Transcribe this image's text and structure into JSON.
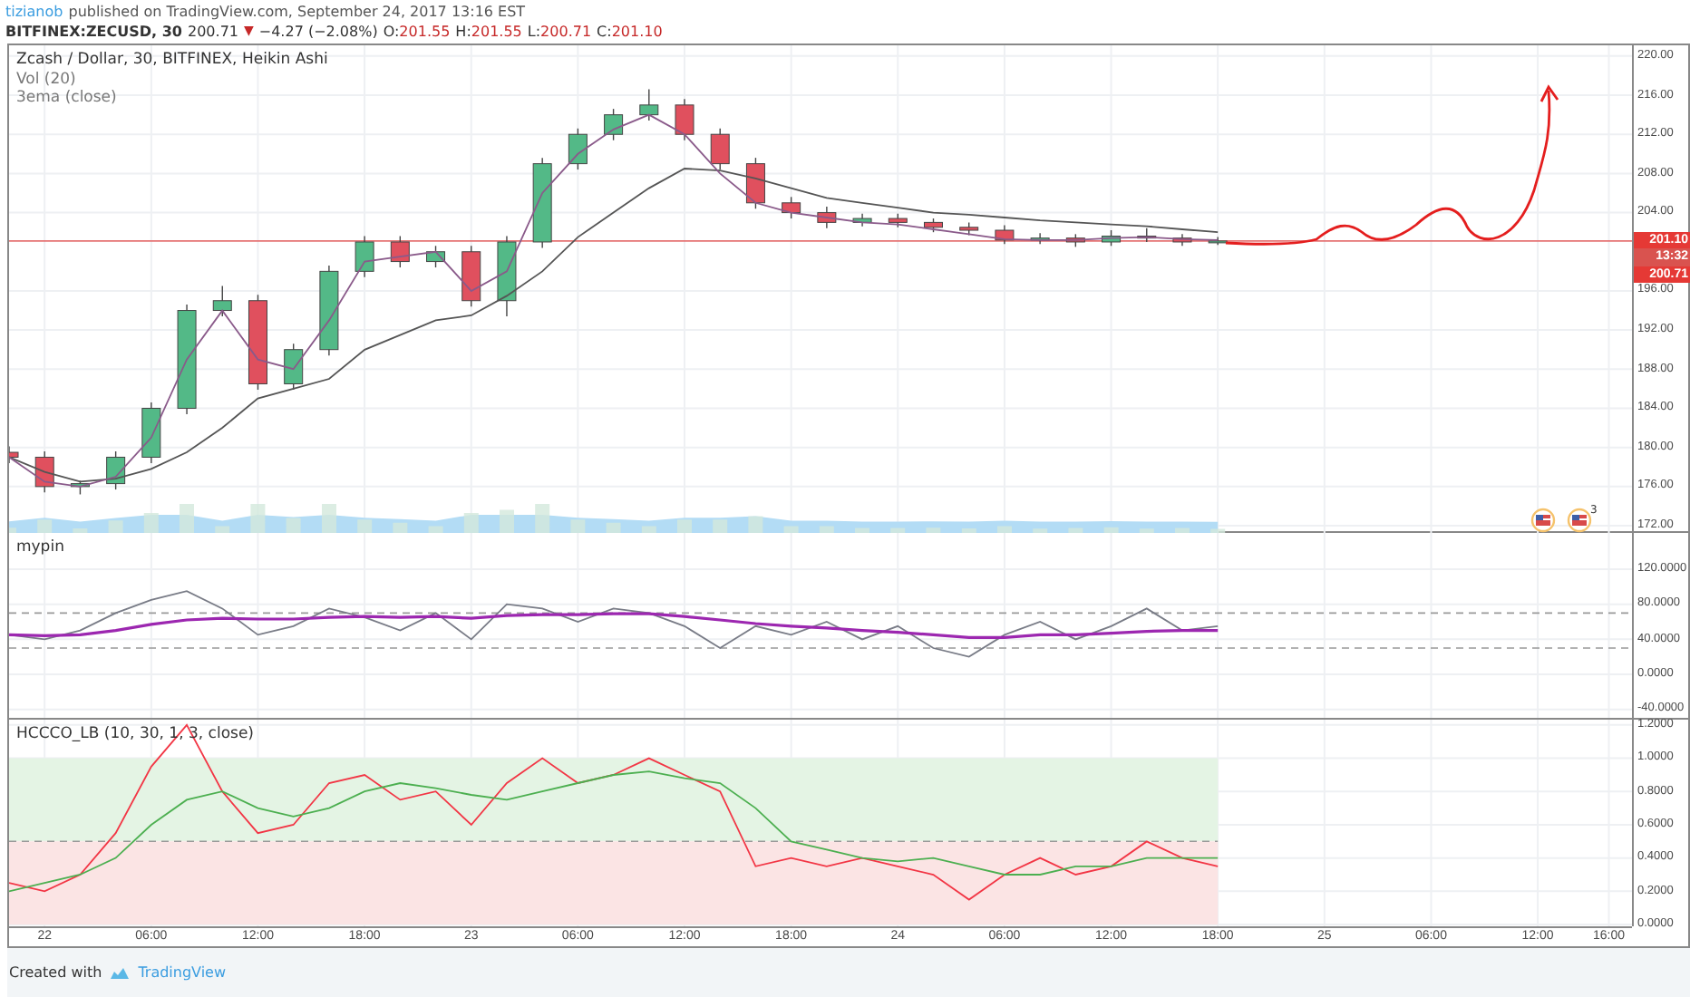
{
  "header": {
    "author": "tizianob",
    "published": "published on TradingView.com, September 24, 2017 13:16 EST",
    "symbol": "BITFINEX:ZECUSD, 30",
    "last": "200.71",
    "direction_glyph": "▼",
    "change": "−4.27 (−2.08%)",
    "ohlc": [
      {
        "label": "O:",
        "value": "201.55"
      },
      {
        "label": "H:",
        "value": "201.55"
      },
      {
        "label": "L:",
        "value": "200.71"
      },
      {
        "label": "C:",
        "value": "201.10"
      }
    ]
  },
  "price_pane": {
    "legend": [
      "Zcash / Dollar, 30, BITFINEX, Heikin Ashi",
      "Vol (20)",
      "3ema (close)"
    ],
    "chart_data": {
      "type": "candlestick",
      "xlim": [
        "2017-09-21T22:00",
        "2017-09-25T20:40"
      ],
      "ylim": [
        171.26,
        221.1
      ],
      "grid": true,
      "x": [
        "2017-09-21T22:00",
        "2017-09-22T00:00",
        "2017-09-22T02:00",
        "2017-09-22T04:00",
        "2017-09-22T06:00",
        "2017-09-22T08:00",
        "2017-09-22T10:00",
        "2017-09-22T12:00",
        "2017-09-22T14:00",
        "2017-09-22T16:00",
        "2017-09-22T18:00",
        "2017-09-22T20:00",
        "2017-09-22T22:00",
        "2017-09-23T00:00",
        "2017-09-23T02:00",
        "2017-09-23T04:00",
        "2017-09-23T06:00",
        "2017-09-23T08:00",
        "2017-09-23T10:00",
        "2017-09-23T12:00",
        "2017-09-23T14:00",
        "2017-09-23T16:00",
        "2017-09-23T18:00",
        "2017-09-23T20:00",
        "2017-09-23T22:00",
        "2017-09-24T00:00",
        "2017-09-24T02:00",
        "2017-09-24T04:00",
        "2017-09-24T06:00",
        "2017-09-24T08:00",
        "2017-09-24T10:00",
        "2017-09-24T12:00",
        "2017-09-24T14:00",
        "2017-09-24T16:00",
        "2017-09-24T18:00"
      ],
      "ohlc": [
        [
          179.5,
          180.1,
          178.4,
          179
        ],
        [
          179,
          179.6,
          175.4,
          176
        ],
        [
          176,
          176.6,
          175.2,
          176.3
        ],
        [
          176.3,
          179.6,
          175.7,
          179
        ],
        [
          179,
          184.6,
          178.4,
          184
        ],
        [
          184,
          194.6,
          183.4,
          194
        ],
        [
          194,
          196.5,
          193.4,
          195
        ],
        [
          195,
          195.6,
          185.9,
          186.5
        ],
        [
          186.5,
          190.6,
          185.9,
          190
        ],
        [
          190,
          198.6,
          189.4,
          198
        ],
        [
          198,
          201.6,
          197.4,
          201
        ],
        [
          201,
          201.6,
          198.4,
          199
        ],
        [
          199,
          200.6,
          198.4,
          200
        ],
        [
          200,
          200.6,
          194.4,
          195
        ],
        [
          195,
          201.6,
          193.4,
          201
        ],
        [
          201,
          209.6,
          200.4,
          209
        ],
        [
          209,
          212.6,
          208.4,
          212
        ],
        [
          212,
          214.6,
          211.4,
          214
        ],
        [
          214,
          216.6,
          213.4,
          215
        ],
        [
          215,
          215.6,
          211.4,
          212
        ],
        [
          212,
          212.6,
          208.4,
          209
        ],
        [
          209,
          209.6,
          204.4,
          205
        ],
        [
          205,
          205.6,
          203.4,
          204
        ],
        [
          204,
          204.6,
          202.4,
          203
        ],
        [
          203,
          203.9,
          202.6,
          203.4
        ],
        [
          203.4,
          203.9,
          202.5,
          203
        ],
        [
          203,
          203.4,
          202,
          202.5
        ],
        [
          202.5,
          203,
          201.7,
          202.2
        ],
        [
          202.2,
          202.7,
          200.8,
          201.2
        ],
        [
          201.2,
          201.9,
          200.8,
          201.4
        ],
        [
          201.4,
          201.8,
          200.5,
          201
        ],
        [
          201,
          202.2,
          200.6,
          201.6
        ],
        [
          201.6,
          202.4,
          201,
          201.4
        ],
        [
          201.4,
          201.8,
          200.6,
          201
        ],
        [
          201,
          201.5,
          200.7,
          201.1
        ]
      ],
      "series": [
        {
          "type": "line",
          "color": "#555555",
          "values": [
            179,
            177.5,
            176.5,
            176.8,
            177.8,
            179.5,
            182,
            185,
            186,
            187,
            190,
            191.5,
            193,
            193.5,
            195.5,
            198,
            201.5,
            204,
            206.5,
            208.5,
            208.3,
            207.5,
            206.5,
            205.5,
            205,
            204.5,
            204,
            203.8,
            203.5,
            203.2,
            203,
            202.8,
            202.6,
            202.3,
            202
          ]
        },
        {
          "type": "line",
          "color": "#8a5a8a",
          "values": [
            179,
            176.5,
            176,
            177,
            181,
            189,
            194,
            189,
            188,
            193,
            199,
            199.5,
            200,
            196,
            198,
            206,
            210,
            212.5,
            214,
            212,
            208,
            205,
            204,
            203.5,
            203,
            202.8,
            202.3,
            201.8,
            201.3,
            201.2,
            201.2,
            201.4,
            201.5,
            201.3,
            201.2
          ]
        }
      ],
      "yticks": [
        {
          "value": 220,
          "label": "220.00"
        },
        {
          "value": 216,
          "label": "216.00"
        },
        {
          "value": 212,
          "label": "212.00"
        },
        {
          "value": 208,
          "label": "208.00"
        },
        {
          "value": 204,
          "label": "204.00"
        },
        {
          "value": 196,
          "label": "196.00"
        },
        {
          "value": 192,
          "label": "192.00"
        },
        {
          "value": 188,
          "label": "188.00"
        },
        {
          "value": 184,
          "label": "184.00"
        },
        {
          "value": 180,
          "label": "180.00"
        },
        {
          "value": 176,
          "label": "176.00"
        },
        {
          "value": 172,
          "label": "172.00"
        }
      ],
      "ref_lines": [
        {
          "axis": "y",
          "value": 201.1,
          "color": "#e57373"
        }
      ]
    },
    "price_tags": [
      {
        "text": "201.10",
        "kind": "last"
      },
      {
        "text": "13:32",
        "kind": "countdown"
      },
      {
        "text": "200.71",
        "kind": "close"
      }
    ],
    "events": [
      {
        "kind": "flag"
      },
      {
        "kind": "flag",
        "badge": "3"
      }
    ]
  },
  "panes": [
    {
      "legend": [
        "mypin"
      ],
      "chart_data": {
        "type": "line",
        "xlim": [
          "2017-09-21T22:00",
          "2017-09-25T20:40"
        ],
        "ylim": [
          -49.7,
          161.4
        ],
        "grid": true,
        "x": [
          "2017-09-21T22:00",
          "2017-09-22T00:00",
          "2017-09-22T02:00",
          "2017-09-22T04:00",
          "2017-09-22T06:00",
          "2017-09-22T08:00",
          "2017-09-22T10:00",
          "2017-09-22T12:00",
          "2017-09-22T14:00",
          "2017-09-22T16:00",
          "2017-09-22T18:00",
          "2017-09-22T20:00",
          "2017-09-22T22:00",
          "2017-09-23T00:00",
          "2017-09-23T02:00",
          "2017-09-23T04:00",
          "2017-09-23T06:00",
          "2017-09-23T08:00",
          "2017-09-23T10:00",
          "2017-09-23T12:00",
          "2017-09-23T14:00",
          "2017-09-23T16:00",
          "2017-09-23T18:00",
          "2017-09-23T20:00",
          "2017-09-23T22:00",
          "2017-09-24T00:00",
          "2017-09-24T02:00",
          "2017-09-24T04:00",
          "2017-09-24T06:00",
          "2017-09-24T08:00",
          "2017-09-24T10:00",
          "2017-09-24T12:00",
          "2017-09-24T14:00",
          "2017-09-24T16:00",
          "2017-09-24T18:00"
        ],
        "series": [
          {
            "color": "#787b86",
            "values": [
              45,
              40,
              50,
              70,
              85,
              95,
              75,
              45,
              55,
              75,
              65,
              50,
              70,
              40,
              80,
              75,
              60,
              75,
              70,
              55,
              30,
              55,
              45,
              60,
              40,
              55,
              30,
              20,
              45,
              60,
              40,
              55,
              75,
              50,
              55
            ]
          },
          {
            "color": "#9c27b0",
            "values": [
              45,
              44,
              45,
              50,
              57,
              62,
              64,
              63,
              63,
              65,
              66,
              65,
              66,
              64,
              67,
              68,
              68,
              69,
              69,
              66,
              62,
              58,
              55,
              53,
              50,
              48,
              45,
              42,
              42,
              45,
              45,
              47,
              49,
              50,
              50
            ]
          }
        ],
        "yticks": [
          {
            "value": 120,
            "label": "120.0000"
          },
          {
            "value": 80,
            "label": "80.0000"
          },
          {
            "value": 40,
            "label": "40.0000"
          },
          {
            "value": 0,
            "label": "0.0000"
          },
          {
            "value": -40,
            "label": "-40.0000"
          }
        ],
        "ref_lines": [
          {
            "axis": "y",
            "value": 70,
            "color": "#999999"
          },
          {
            "axis": "y",
            "value": 30,
            "color": "#999999"
          }
        ]
      }
    },
    {
      "legend": [
        "HCCCO_LB (10, 30, 1, 3, close)"
      ],
      "chart_data": {
        "type": "line",
        "xlim": [
          "2017-09-21T22:00",
          "2017-09-25T20:40"
        ],
        "ylim": [
          -0.0106,
          1.232
        ],
        "grid": true,
        "x": [
          "2017-09-21T22:00",
          "2017-09-22T00:00",
          "2017-09-22T02:00",
          "2017-09-22T04:00",
          "2017-09-22T06:00",
          "2017-09-22T08:00",
          "2017-09-22T10:00",
          "2017-09-22T12:00",
          "2017-09-22T14:00",
          "2017-09-22T16:00",
          "2017-09-22T18:00",
          "2017-09-22T20:00",
          "2017-09-22T22:00",
          "2017-09-23T00:00",
          "2017-09-23T02:00",
          "2017-09-23T04:00",
          "2017-09-23T06:00",
          "2017-09-23T08:00",
          "2017-09-23T10:00",
          "2017-09-23T12:00",
          "2017-09-23T14:00",
          "2017-09-23T16:00",
          "2017-09-23T18:00",
          "2017-09-23T20:00",
          "2017-09-23T22:00",
          "2017-09-24T00:00",
          "2017-09-24T02:00",
          "2017-09-24T04:00",
          "2017-09-24T06:00",
          "2017-09-24T08:00",
          "2017-09-24T10:00",
          "2017-09-24T12:00",
          "2017-09-24T14:00",
          "2017-09-24T16:00",
          "2017-09-24T18:00"
        ],
        "series": [
          {
            "color": "#f23645",
            "values": [
              0.25,
              0.2,
              0.3,
              0.55,
              0.95,
              1.2,
              0.8,
              0.55,
              0.6,
              0.85,
              0.9,
              0.75,
              0.8,
              0.6,
              0.85,
              1.0,
              0.85,
              0.9,
              1.0,
              0.9,
              0.8,
              0.35,
              0.4,
              0.35,
              0.4,
              0.35,
              0.3,
              0.15,
              0.3,
              0.4,
              0.3,
              0.35,
              0.5,
              0.4,
              0.35
            ]
          },
          {
            "color": "#4caf50",
            "values": [
              0.2,
              0.25,
              0.3,
              0.4,
              0.6,
              0.75,
              0.8,
              0.7,
              0.65,
              0.7,
              0.8,
              0.85,
              0.82,
              0.78,
              0.75,
              0.8,
              0.85,
              0.9,
              0.92,
              0.88,
              0.85,
              0.7,
              0.5,
              0.45,
              0.4,
              0.38,
              0.4,
              0.35,
              0.3,
              0.3,
              0.35,
              0.35,
              0.4,
              0.4,
              0.4
            ]
          }
        ],
        "yticks": [
          {
            "value": 1.2,
            "label": "1.2000"
          },
          {
            "value": 1,
            "label": "1.0000"
          },
          {
            "value": 0.8,
            "label": "0.8000"
          },
          {
            "value": 0.6,
            "label": "0.6000"
          },
          {
            "value": 0.4,
            "label": "0.4000"
          },
          {
            "value": 0.2,
            "label": "0.2000"
          },
          {
            "value": 0,
            "label": "0.0000"
          }
        ],
        "xticks": [
          {
            "value": "2017-09-22T00:00",
            "label": "22"
          },
          {
            "value": "2017-09-22T06:00",
            "label": "06:00"
          },
          {
            "value": "2017-09-22T12:00",
            "label": "12:00"
          },
          {
            "value": "2017-09-22T18:00",
            "label": "18:00"
          },
          {
            "value": "2017-09-23T00:00",
            "label": "23"
          },
          {
            "value": "2017-09-23T06:00",
            "label": "06:00"
          },
          {
            "value": "2017-09-23T12:00",
            "label": "12:00"
          },
          {
            "value": "2017-09-23T18:00",
            "label": "18:00"
          },
          {
            "value": "2017-09-24T00:00",
            "label": "24"
          },
          {
            "value": "2017-09-24T06:00",
            "label": "06:00"
          },
          {
            "value": "2017-09-24T12:00",
            "label": "12:00"
          },
          {
            "value": "2017-09-24T18:00",
            "label": "18:00"
          },
          {
            "value": "2017-09-25T00:00",
            "label": "25"
          },
          {
            "value": "2017-09-25T06:00",
            "label": "06:00"
          },
          {
            "value": "2017-09-25T12:00",
            "label": "12:00"
          },
          {
            "value": "2017-09-25T16:00",
            "label": "16:00"
          }
        ],
        "bands": [
          {
            "axis": "y",
            "from": 0.5,
            "to": 1,
            "color": "#e4f4e4"
          },
          {
            "axis": "y",
            "from": 0,
            "to": 0.5,
            "color": "#fbe4e4"
          }
        ],
        "ref_lines": [
          {
            "axis": "y",
            "value": 0.5,
            "color": "#999999"
          }
        ]
      }
    }
  ],
  "footer": {
    "text": "Created with",
    "brand": "TradingView"
  }
}
